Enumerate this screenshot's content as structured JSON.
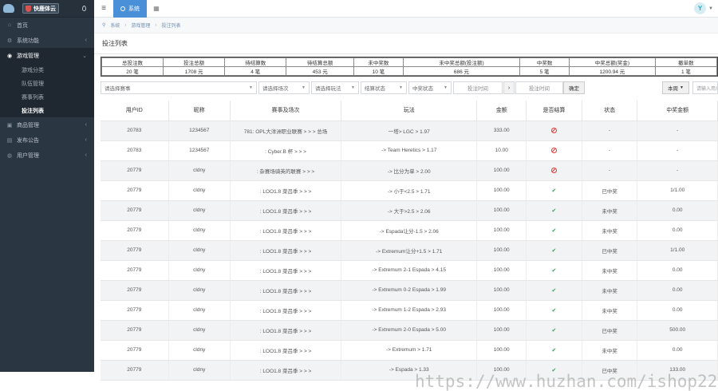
{
  "brand": {
    "name": "快鹿体云"
  },
  "topbar": {
    "system_tab": "系统"
  },
  "breadcrumb": [
    "系统",
    "游戏管理",
    "投注列表"
  ],
  "sidebar": {
    "items": [
      {
        "label": "首页",
        "icon": "home-icon"
      },
      {
        "label": "系统功能",
        "icon": "gear-icon",
        "chevron": "‹"
      },
      {
        "label": "游戏管理",
        "icon": "gamepad-icon",
        "chevron": "⌄"
      }
    ],
    "sub_items": [
      "游戏分类",
      "队伍管理",
      "赛事列表",
      "投注列表"
    ],
    "bottom_items": [
      {
        "label": "商品管理",
        "icon": "cart-icon",
        "chevron": "‹"
      },
      {
        "label": "发布公告",
        "icon": "bell-icon",
        "chevron": "‹"
      },
      {
        "label": "用户管理",
        "icon": "user-icon",
        "chevron": "‹"
      }
    ]
  },
  "page": {
    "title": "投注列表"
  },
  "summary": {
    "headers": [
      "总投注数",
      "投注总额",
      "待结算数",
      "待结算总额",
      "未中奖数",
      "未中奖总额(投注额)",
      "中奖数",
      "中奖总额(奖金)",
      "撤单数"
    ],
    "values": [
      "20 笔",
      "1708 元",
      "4 笔",
      "453 元",
      "10 笔",
      "686 元",
      "5 笔",
      "1200.94 元",
      "1 笔"
    ]
  },
  "filters": {
    "event": "请选择赛事",
    "match": "请选择场次",
    "play": "请选择玩法",
    "settle": "结算状态",
    "win": "中奖状态",
    "start_time": "投注时间",
    "end_time": "投注时间",
    "confirm": "确定",
    "page_size": "本周",
    "search_placeholder": "请输入用户ID"
  },
  "table": {
    "columns": [
      "用户ID",
      "昵称",
      "赛事及场次",
      "玩法",
      "金额",
      "是否结算",
      "状态",
      "中奖金额"
    ],
    "rows": [
      {
        "uid": "20783",
        "nick": "1234567",
        "event": "781: OPL大洋洲职业联赛 > > > 总场",
        "play": "一塔> LGC > 1.97",
        "amount": "333.00",
        "settled": "ban",
        "status": "-",
        "prize": "-"
      },
      {
        "uid": "20783",
        "nick": "1234567",
        "event": ": Cyber.B 杯 > > >",
        "play": "-> Team Heretics > 1.17",
        "amount": "10.00",
        "settled": "ban",
        "status": "-",
        "prize": "-"
      },
      {
        "uid": "20779",
        "nick": "cldny",
        "event": ": 杂赛场骑英的联赛 > > >",
        "play": "-> 比分为单 > 2.00",
        "amount": "100.00",
        "settled": "ban",
        "status": "-",
        "prize": "-"
      },
      {
        "uid": "20779",
        "nick": "cldny",
        "event": ": LOO1.8 菜吕季 > > >",
        "play": "-> 小于<2.5 > 1.71",
        "amount": "100.00",
        "settled": "check",
        "status": "已中奖",
        "prize": "1/1.00"
      },
      {
        "uid": "20779",
        "nick": "cldny",
        "event": ": LOO1.8 菜吕季 > > >",
        "play": "-> 大于>2.5 > 2.06",
        "amount": "100.00",
        "settled": "check",
        "status": "未中奖",
        "prize": "0.00"
      },
      {
        "uid": "20779",
        "nick": "cldny",
        "event": ": LOO1.8 菜吕季 > > >",
        "play": "-> Espada让分-1.5 > 2.06",
        "amount": "100.00",
        "settled": "check",
        "status": "未中奖",
        "prize": "0.00"
      },
      {
        "uid": "20779",
        "nick": "cldny",
        "event": ": LOO1.8 菜吕季 > > >",
        "play": "-> Extremum让分+1.5 > 1.71",
        "amount": "100.00",
        "settled": "check",
        "status": "已中奖",
        "prize": "1/1.00"
      },
      {
        "uid": "20779",
        "nick": "cldny",
        "event": ": LOO1.8 菜吕季 > > >",
        "play": "-> Extremum 2-1 Espada > 4.15",
        "amount": "100.00",
        "settled": "check",
        "status": "未中奖",
        "prize": "0.00"
      },
      {
        "uid": "20779",
        "nick": "cldny",
        "event": ": LOO1.8 菜吕季 > > >",
        "play": "-> Extremum 0-2 Espada > 1.99",
        "amount": "100.00",
        "settled": "check",
        "status": "未中奖",
        "prize": "0.00"
      },
      {
        "uid": "20779",
        "nick": "cldny",
        "event": ": LOO1.8 菜吕季 > > >",
        "play": "-> Extremum 1-2 Espada > 2.93",
        "amount": "100.00",
        "settled": "check",
        "status": "未中奖",
        "prize": "0.00"
      },
      {
        "uid": "20779",
        "nick": "cldny",
        "event": ": LOO1.8 菜吕季 > > >",
        "play": "-> Extremum 2-0 Espada > 5.00",
        "amount": "100.00",
        "settled": "check",
        "status": "已中奖",
        "prize": "500.00"
      },
      {
        "uid": "20779",
        "nick": "cldny",
        "event": ": LOO1.8 菜吕季 > > >",
        "play": "-> Extremum > 1.71",
        "amount": "100.00",
        "settled": "check",
        "status": "未中奖",
        "prize": "0.00"
      },
      {
        "uid": "20779",
        "nick": "cldny",
        "event": ": LOO1.8 菜吕季 > > >",
        "play": "-> Espada > 1.33",
        "amount": "100.00",
        "settled": "check",
        "status": "已中奖",
        "prize": "133.00"
      }
    ]
  },
  "watermark": "https://www.huzhan.com/ishop22512"
}
